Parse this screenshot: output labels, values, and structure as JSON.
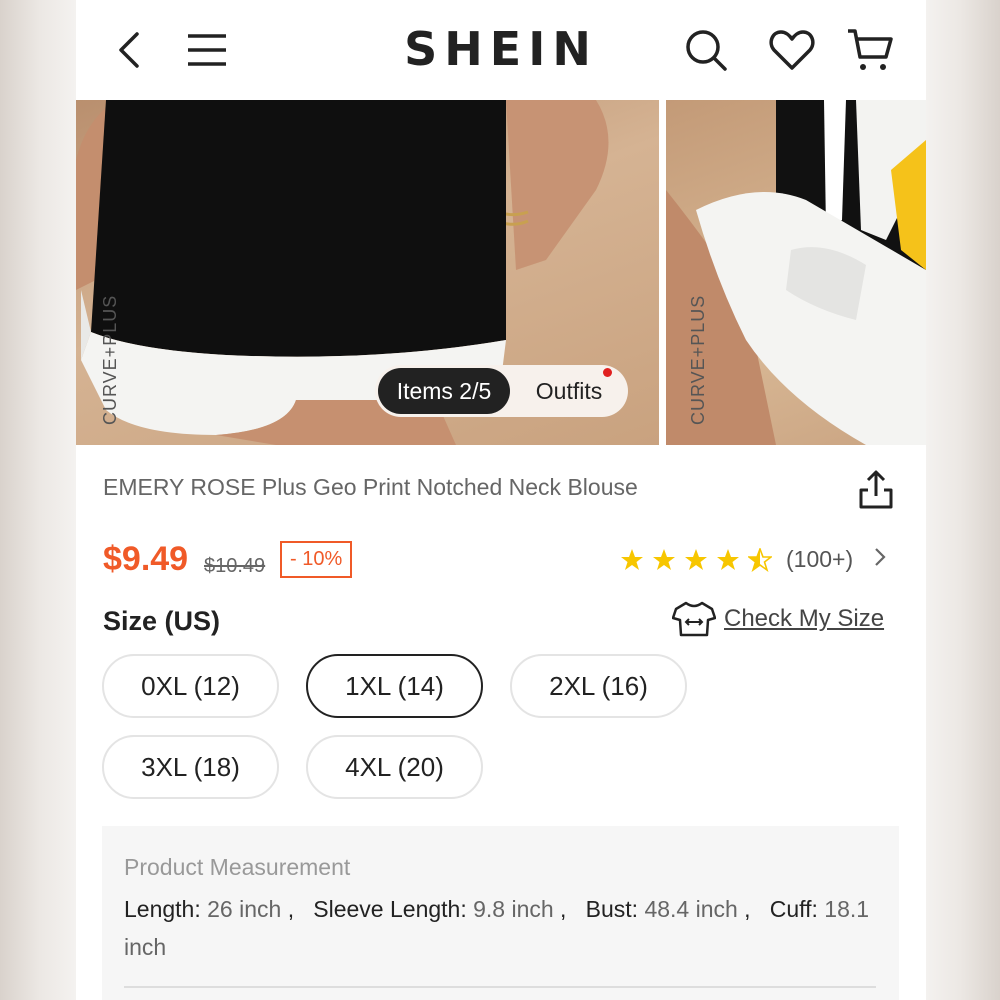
{
  "header": {
    "logo": "SHEIN",
    "icons": [
      "back-arrow-icon",
      "menu-icon",
      "search-icon",
      "heart-icon",
      "cart-icon"
    ]
  },
  "gallery": {
    "brand_label": "CURVE+PLUS",
    "tabs": {
      "items_label": "Items 2/5",
      "outfits_label": "Outfits"
    }
  },
  "product": {
    "title": "EMERY ROSE Plus Geo Print Notched Neck Blouse",
    "price": "$9.49",
    "original_price": "$10.49",
    "discount": "- 10%",
    "rating": 4.5,
    "rating_count": "(100+)"
  },
  "sizes": {
    "label": "Size (US)",
    "check_my_size": "Check My Size",
    "options": [
      "0XL (12)",
      "1XL (14)",
      "2XL (16)",
      "3XL (18)",
      "4XL (20)"
    ],
    "selected": "1XL (14)"
  },
  "measurement": {
    "title": "Product Measurement",
    "length_label": "Length:",
    "length_value": "26 inch",
    "sleeve_label": "Sleeve Length:",
    "sleeve_value": "9.8 inch",
    "bust_label": "Bust:",
    "bust_value": "48.4 inch",
    "cuff_label": "Cuff:",
    "cuff_value": "18.1 inch"
  },
  "colors": {
    "accent": "#f05a28",
    "star": "#f7c600",
    "text": "#222222"
  }
}
